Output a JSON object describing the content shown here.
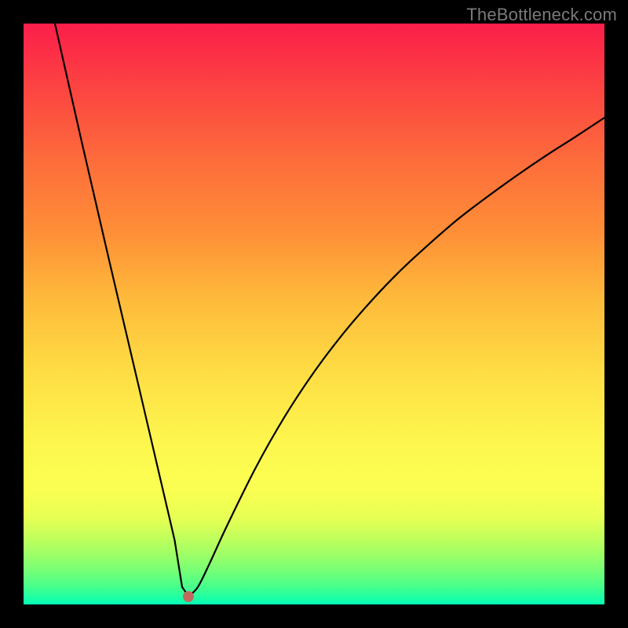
{
  "watermark": "TheBottleneck.com",
  "chart_data": {
    "type": "line",
    "title": "",
    "xlabel": "",
    "ylabel": "",
    "background_gradient": {
      "top": "#fb1e4a",
      "bottom": "#04ffb6"
    },
    "curve": {
      "description": "V-shaped bottleneck curve: steep linear descent from top-left to the minimum near x≈0.28, then a concave-up rise that flattens toward the right edge.",
      "minimum_x_fraction": 0.284,
      "minimum_y_fraction": 0.986,
      "left_top_x_fraction": 0.054,
      "right_end_y_fraction": 0.162,
      "series": [
        {
          "name": "bottleneck-curve",
          "x": [
            0.054,
            0.1,
            0.15,
            0.2,
            0.25,
            0.26,
            0.273,
            0.284,
            0.3,
            0.32,
            0.35,
            0.4,
            0.45,
            0.5,
            0.55,
            0.6,
            0.65,
            0.7,
            0.75,
            0.8,
            0.85,
            0.9,
            0.95,
            1.0
          ],
          "y": [
            0.0,
            0.203,
            0.419,
            0.632,
            0.846,
            0.889,
            0.97,
            0.986,
            0.97,
            0.93,
            0.865,
            0.764,
            0.676,
            0.6,
            0.534,
            0.476,
            0.424,
            0.378,
            0.335,
            0.297,
            0.261,
            0.227,
            0.195,
            0.162
          ]
        }
      ]
    },
    "marker": {
      "x_fraction": 0.284,
      "y_fraction": 0.986,
      "color": "#c06a5e",
      "radius_px": 7
    },
    "note": "x and y are fractions of the plot area width and height; origin at top-left of the colored panel, y increases downward."
  }
}
